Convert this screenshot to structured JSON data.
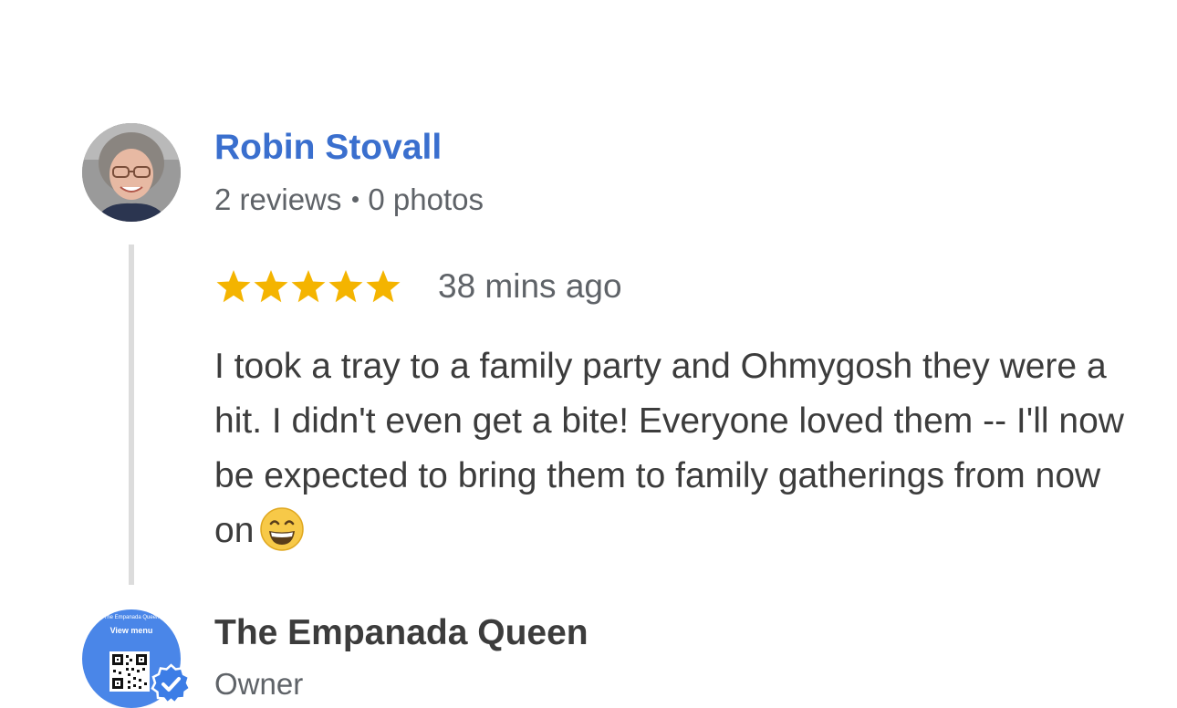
{
  "review": {
    "reviewer": {
      "name": "Robin Stovall",
      "reviews_count": "2 reviews",
      "photos_count": "0 photos",
      "avatar_icon": "reviewer-photo"
    },
    "rating": 5,
    "rating_max": 5,
    "time_ago": "38 mins ago",
    "text": "I took a tray to a family party and Ohmygosh they were a hit. I didn't even get a bite! Everyone loved them -- I'll now be expected to bring them to family gatherings from now on",
    "emoji": "grinning-face-with-smiling-eyes"
  },
  "owner_reply": {
    "name": "The Empanada Queen",
    "role": "Owner",
    "avatar": {
      "title": "The Empanada Queen",
      "label": "View menu",
      "icon": "qr-code-icon"
    },
    "verified_icon": "verified-check-icon"
  },
  "colors": {
    "link_blue": "#3a6fce",
    "star_gold": "#f4b400",
    "meta_gray": "#5f6368",
    "text_dark": "#3c3c3c",
    "owner_avatar_blue": "#4a86e8",
    "thread_rail": "#dcdcdc"
  }
}
